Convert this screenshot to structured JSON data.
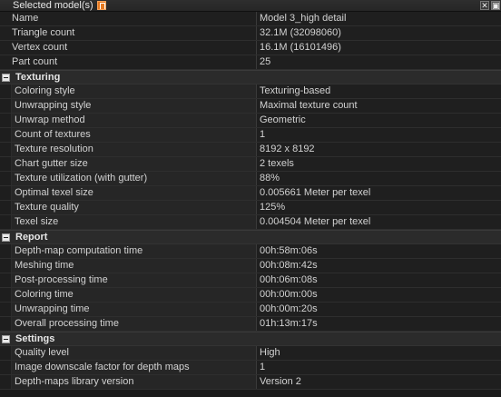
{
  "panel": {
    "title": "Selected model(s)",
    "close_label": "✕",
    "dock_label": "▣"
  },
  "top_rows": [
    {
      "name": "Name",
      "value": "Model 3_high detail"
    },
    {
      "name": "Triangle count",
      "value": "32.1M (32098060)"
    },
    {
      "name": "Vertex count",
      "value": "16.1M (16101496)"
    },
    {
      "name": "Part count",
      "value": "25"
    }
  ],
  "groups": [
    {
      "label": "Texturing",
      "rows": [
        {
          "name": "Coloring style",
          "value": "Texturing-based"
        },
        {
          "name": "Unwrapping style",
          "value": "Maximal texture count"
        },
        {
          "name": "Unwrap method",
          "value": "Geometric"
        },
        {
          "name": "Count of textures",
          "value": "1"
        },
        {
          "name": "Texture resolution",
          "value": "8192 x 8192"
        },
        {
          "name": "Chart gutter size",
          "value": "2 texels"
        },
        {
          "name": "Texture utilization (with gutter)",
          "value": "88%"
        },
        {
          "name": "Optimal texel size",
          "value": "0.005661 Meter per texel"
        },
        {
          "name": "Texture quality",
          "value": "125%"
        },
        {
          "name": "Texel size",
          "value": "0.004504 Meter per texel"
        }
      ]
    },
    {
      "label": "Report",
      "rows": [
        {
          "name": "Depth-map computation time",
          "value": "00h:58m:06s"
        },
        {
          "name": "Meshing time",
          "value": "00h:08m:42s"
        },
        {
          "name": "Post-processing time",
          "value": "00h:06m:08s"
        },
        {
          "name": "Coloring time",
          "value": "00h:00m:00s"
        },
        {
          "name": "Unwrapping time",
          "value": "00h:00m:20s"
        },
        {
          "name": "Overall processing time",
          "value": "01h:13m:17s"
        }
      ]
    },
    {
      "label": "Settings",
      "rows": [
        {
          "name": "Quality level",
          "value": "High"
        },
        {
          "name": "Image downscale factor for depth maps",
          "value": "1"
        },
        {
          "name": "Depth-maps library version",
          "value": "Version 2"
        }
      ]
    }
  ]
}
